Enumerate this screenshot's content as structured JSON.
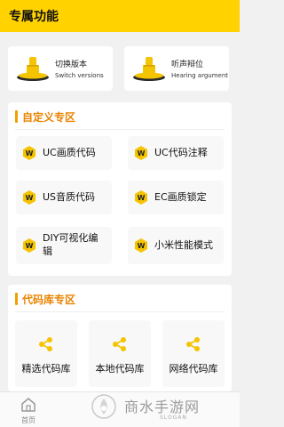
{
  "header": {
    "title": "专属功能"
  },
  "top_cards": [
    {
      "label": "切换版本",
      "sub": "Switch versions",
      "icon": "stamp-icon"
    },
    {
      "label": "听声辩位",
      "sub": "Hearing argument",
      "icon": "stamp-icon"
    }
  ],
  "custom_section": {
    "title": "自定义专区",
    "items": [
      {
        "label": "UC画质代码"
      },
      {
        "label": "UC代码注释"
      },
      {
        "label": "US音质代码"
      },
      {
        "label": "EC画质锁定"
      },
      {
        "label": "DIY可视化编辑"
      },
      {
        "label": "小米性能模式"
      }
    ]
  },
  "library_section": {
    "title": "代码库专区",
    "items": [
      {
        "label": "精选代码库"
      },
      {
        "label": "本地代码库"
      },
      {
        "label": "网络代码库"
      }
    ]
  },
  "tabbar": {
    "home_label": "首页"
  },
  "watermark": {
    "text": "商水手游网",
    "sub": "SLOGAN"
  },
  "colors": {
    "accent": "#ffd200",
    "section_title": "#e88400",
    "icon_yellow": "#f5c400"
  }
}
